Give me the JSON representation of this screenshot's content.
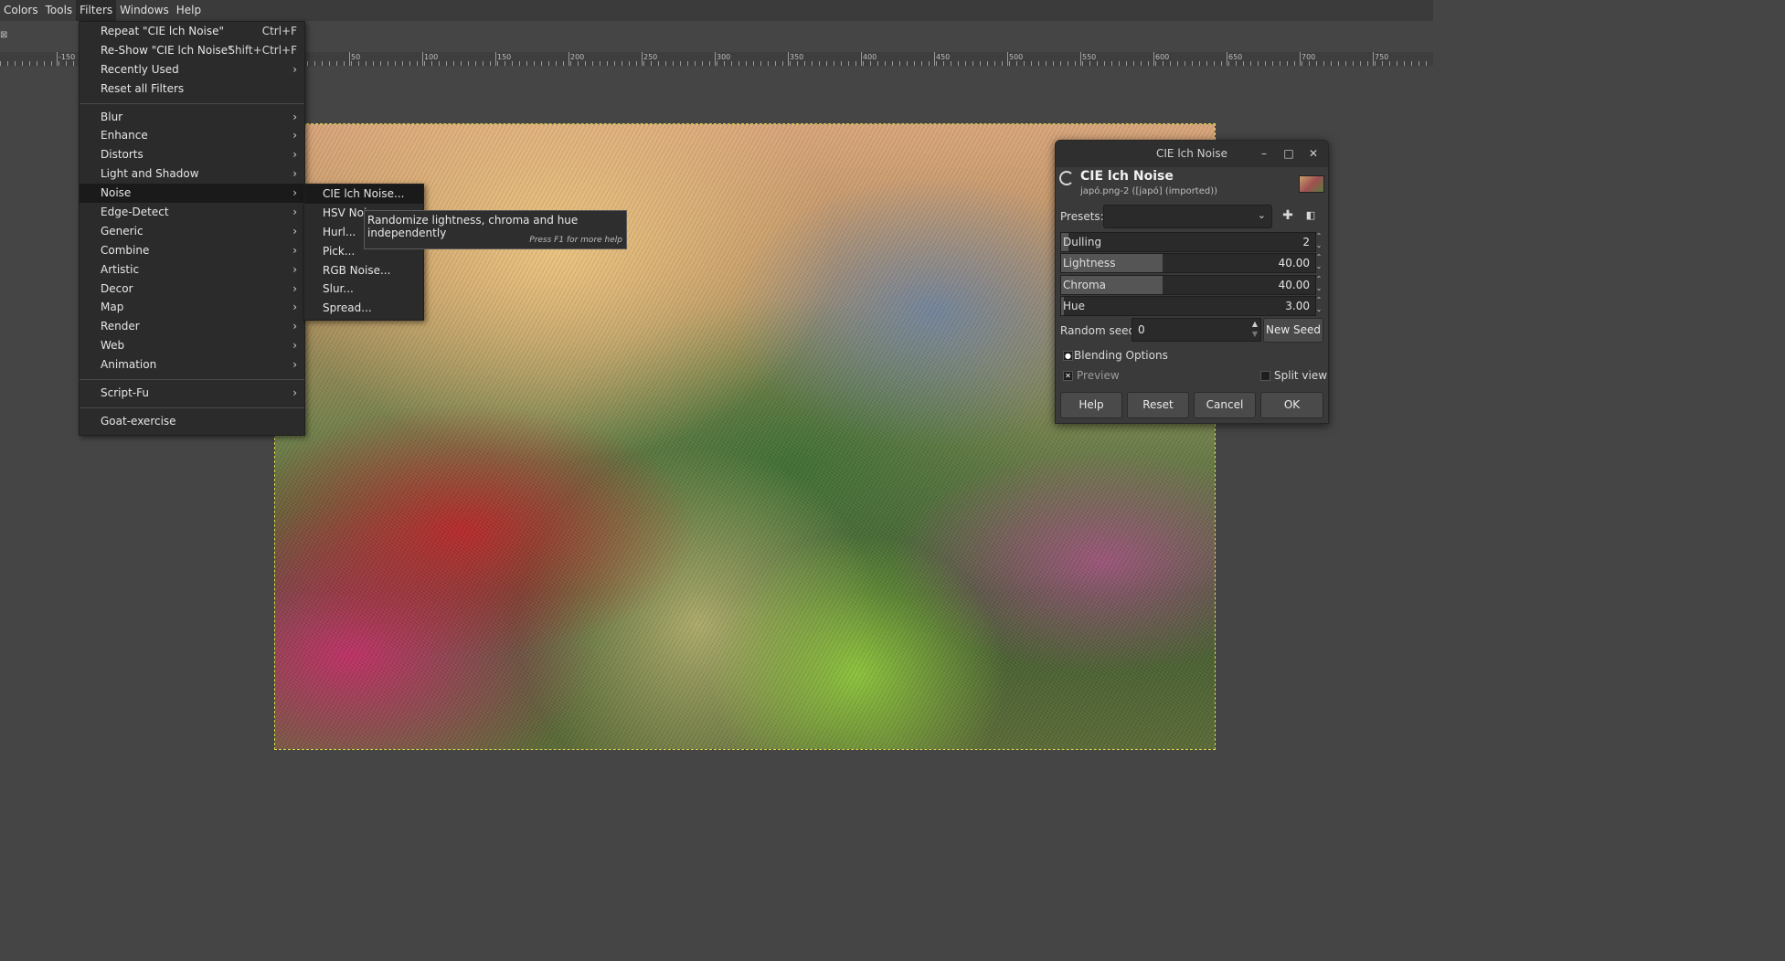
{
  "menubar": {
    "items": [
      "Colors",
      "Tools",
      "Filters",
      "Windows",
      "Help"
    ],
    "active": "Filters"
  },
  "ruler": {
    "labels": [
      "-150",
      "50",
      "100",
      "150",
      "200",
      "250",
      "300",
      "350",
      "400",
      "450",
      "500",
      "550",
      "600",
      "650",
      "700",
      "750"
    ]
  },
  "filters_menu": {
    "repeat_label": "Repeat \"CIE lch Noise\"",
    "repeat_accel": "Ctrl+F",
    "reshow_label": "Re-Show \"CIE lch Noise\"",
    "reshow_accel": "Shift+Ctrl+F",
    "recently_used": "Recently Used",
    "reset_all": "Reset all Filters",
    "categories": [
      "Blur",
      "Enhance",
      "Distorts",
      "Light and Shadow",
      "Noise",
      "Edge-Detect",
      "Generic",
      "Combine",
      "Artistic",
      "Decor",
      "Map",
      "Render",
      "Web",
      "Animation"
    ],
    "script_fu": "Script-Fu",
    "goat": "Goat-exercise",
    "selected": "Noise"
  },
  "noise_submenu": {
    "items": [
      "CIE lch Noise...",
      "HSV Noise...",
      "Hurl...",
      "Pick...",
      "RGB Noise...",
      "Slur...",
      "Spread..."
    ],
    "hsv_visible": "HSV Nois"
  },
  "tooltip": {
    "text": "Randomize lightness, chroma and hue independently",
    "help": "Press F1 for more help"
  },
  "dialog": {
    "window_title": "CIE lch Noise",
    "title": "CIE lch Noise",
    "subtitle": "japó.png-2 ([japó] (imported))",
    "presets_label": "Presets:",
    "presets_value": "",
    "params": [
      {
        "label": "Dulling",
        "value": "2",
        "fraction": 0.03
      },
      {
        "label": "Lightness",
        "value": "40.00",
        "fraction": 0.4
      },
      {
        "label": "Chroma",
        "value": "40.00",
        "fraction": 0.4
      },
      {
        "label": "Hue",
        "value": "3.00",
        "fraction": 0.01
      }
    ],
    "random_seed_label": "Random seed",
    "random_seed_value": "0",
    "new_seed": "New Seed",
    "blending_options": "Blending Options",
    "preview": "Preview",
    "split_view": "Split view",
    "buttons": {
      "help": "Help",
      "reset": "Reset",
      "cancel": "Cancel",
      "ok": "OK"
    }
  },
  "icons": {
    "submenu_arrow": "chevron-right-icon",
    "close": "close-icon",
    "minimize": "minimize-icon",
    "maximize": "maximize-icon",
    "add_preset": "plus-icon",
    "manage_presets": "menu-icon"
  }
}
